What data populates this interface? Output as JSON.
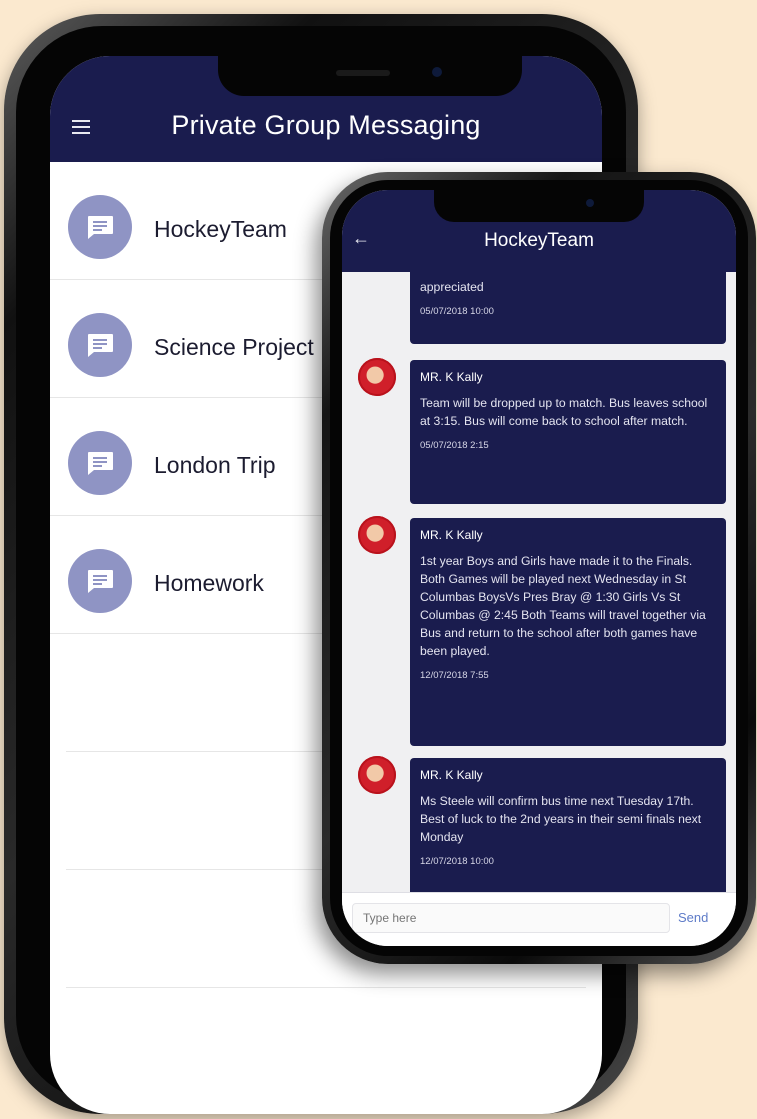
{
  "back_screen": {
    "title": "Private Group Messaging",
    "groups": [
      {
        "label": "HockeyTeam"
      },
      {
        "label": "Science Project"
      },
      {
        "label": "London Trip"
      },
      {
        "label": "Homework"
      }
    ]
  },
  "front_screen": {
    "title": "HockeyTeam",
    "back_icon": "arrow-left-icon",
    "partial_message": {
      "body": "appreciated",
      "time": "05/07/2018 10:00"
    },
    "messages": [
      {
        "sender": "MR. K Kally",
        "body": "Team will be dropped up to match. Bus leaves school at 3:15. Bus will come back to school after match.",
        "time": "05/07/2018 2:15"
      },
      {
        "sender": "MR. K Kally",
        "body": "1st year Boys and Girls have made it to the Finals. Both Games will be played next Wednesday in St Columbas BoysVs Pres Bray @ 1:30 Girls Vs St Columbas @ 2:45 Both Teams will travel together via Bus and return to the school after both games have been played.",
        "time": "12/07/2018 7:55"
      },
      {
        "sender": "MR. K Kally",
        "body": "Ms Steele will confirm bus time next Tuesday 17th. Best of luck to the 2nd years in their semi finals next Monday",
        "time": "12/07/2018 10:00"
      }
    ],
    "composer": {
      "placeholder": "Type here",
      "send_label": "Send"
    }
  },
  "colors": {
    "navy": "#1a1c4e",
    "avatar_lavender": "#8f94c4",
    "background": "#fbe9cf",
    "send_blue": "#5e7bc8"
  }
}
